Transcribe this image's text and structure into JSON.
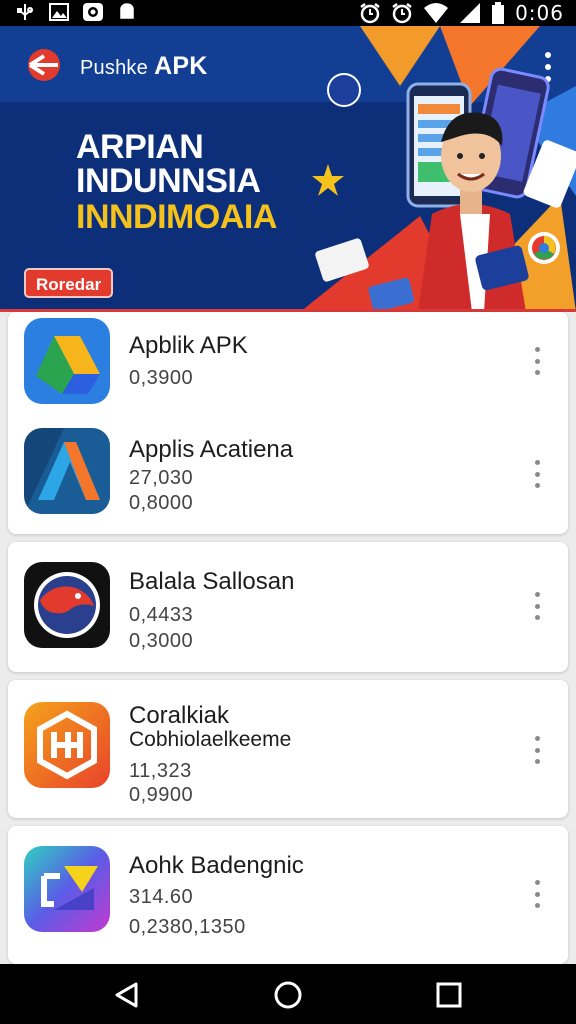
{
  "status_bar": {
    "time": "0:06",
    "left_icons": [
      "usb-icon",
      "image-icon",
      "record-icon",
      "android-icon"
    ],
    "right_icons": [
      "alarm-icon",
      "alarm-icon",
      "wifi-icon",
      "signal-icon",
      "battery-icon"
    ]
  },
  "header": {
    "app_title_prefix": "Pushke",
    "app_title_suffix": "APK",
    "headline_line1": "ARPIAN",
    "headline_line2": "INDUNNSIA",
    "headline_line3": "INNDIMOAIA",
    "badge": "Roredar",
    "colors": {
      "background": "#0f3b8f",
      "accent_red": "#e23b2e",
      "accent_yellow": "#f5c21b"
    }
  },
  "apps": [
    {
      "name": "Apblik APK",
      "sub": "",
      "meta1": "0,3900",
      "meta2": ""
    },
    {
      "name": "Applis Acatiena",
      "sub": "",
      "meta1": "27,030",
      "meta2": "0,8000"
    },
    {
      "name": "Balala Sallosan",
      "sub": "",
      "meta1": "0,4433",
      "meta2": "0,3000"
    },
    {
      "name": "Coralkiak",
      "sub": "Cobhiolaelkeeme",
      "meta1": "11,323",
      "meta2": "0,9900"
    },
    {
      "name": "Aohk Badengnic",
      "sub": "",
      "meta1": "314.60",
      "meta2": "0,2380,1350"
    }
  ],
  "nav": {
    "icons": [
      "back-icon",
      "home-icon",
      "recents-icon"
    ]
  }
}
